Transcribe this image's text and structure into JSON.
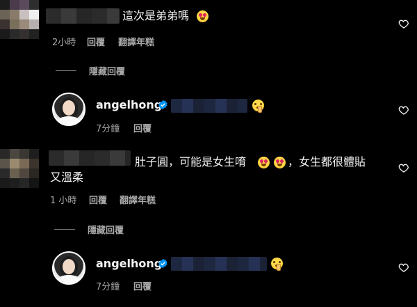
{
  "comments": [
    {
      "text": "這次是弟弟嗎",
      "time": "2小時",
      "reply_label": "回覆",
      "translate_label": "翻譯年糕",
      "hide_replies_label": "隱藏回覆",
      "reply": {
        "username": "angelhong",
        "time": "7分鐘",
        "reply_label": "回覆",
        "emoji": "shushing-face-emoji"
      }
    },
    {
      "text_part1": "肚子圓，可能是女生唷",
      "text_part2": "，女生都很體貼",
      "text_line2": "又溫柔",
      "time": "1 小時",
      "reply_label": "回覆",
      "translate_label": "翻譯年糕",
      "hide_replies_label": "隱藏回覆",
      "reply": {
        "username": "angelhong",
        "time": "7分鐘",
        "reply_label": "回覆",
        "emoji": "shushing-face-emoji"
      }
    }
  ],
  "icons": {
    "like": "heart-outline-icon",
    "verified": "verified-badge-icon",
    "heart_eyes": "smiling-face-with-heart-eyes-emoji"
  },
  "colors": {
    "background": "#000000",
    "text": "#f5f5f5",
    "meta": "#a8a8a8",
    "verified": "#0095f6",
    "heart_eyes_accent": "#e0245e"
  }
}
